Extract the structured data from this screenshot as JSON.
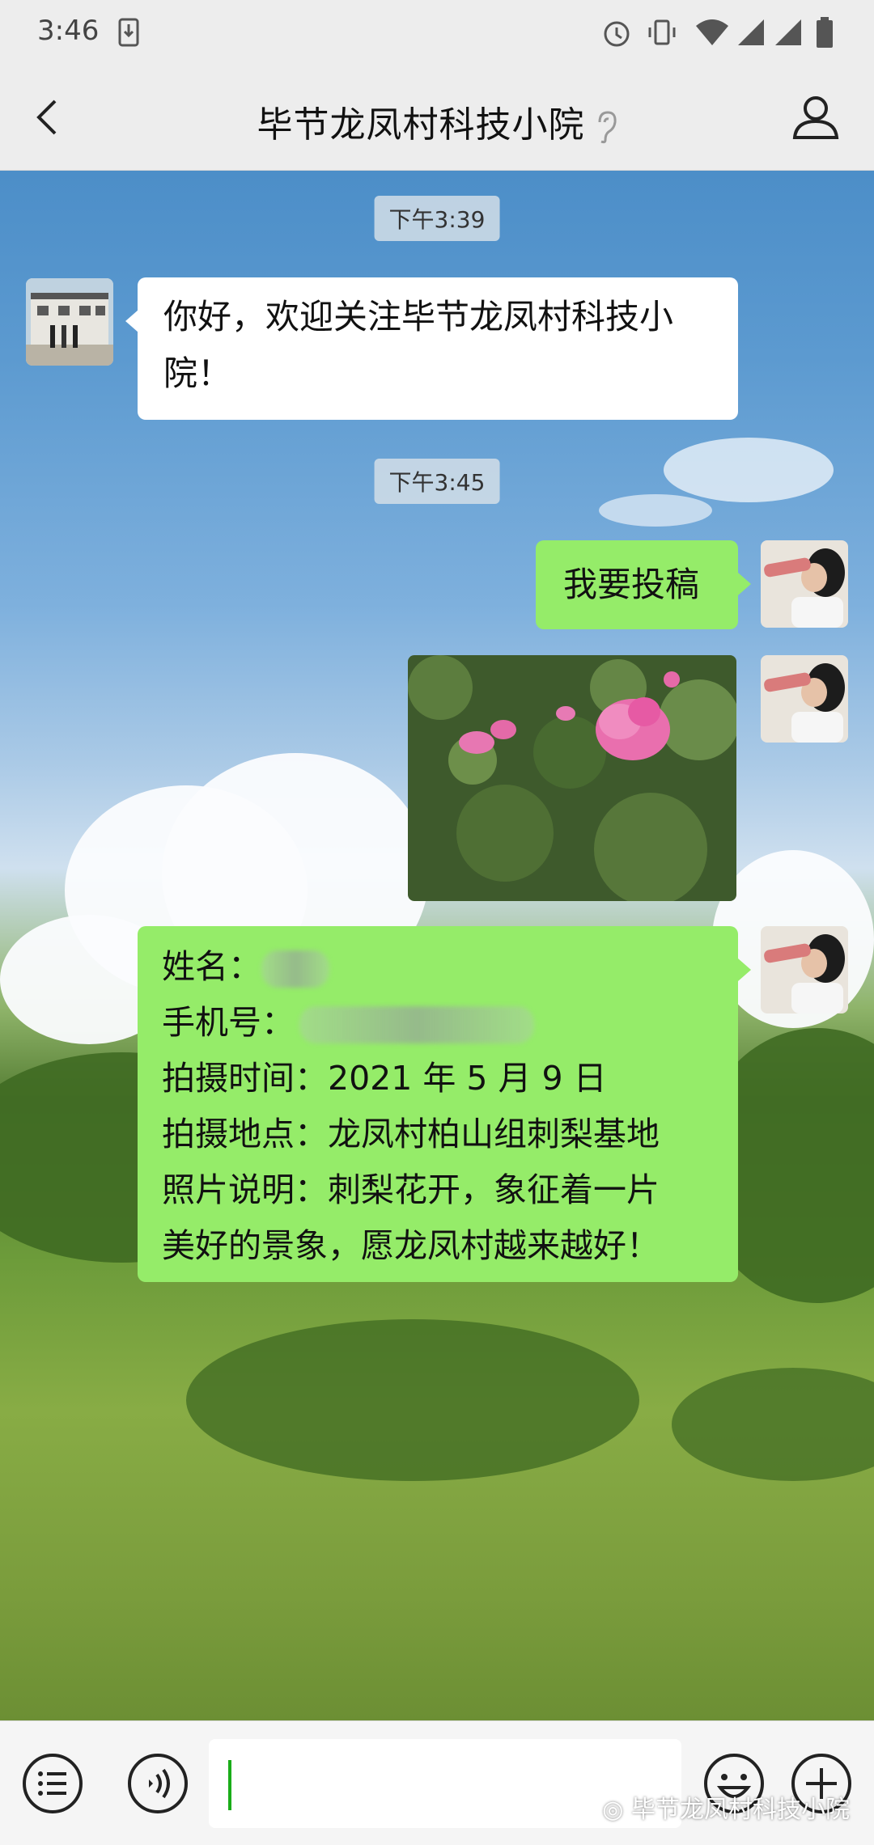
{
  "status_bar": {
    "time": "3:46"
  },
  "header": {
    "title": "毕节龙凤村科技小院"
  },
  "chat": {
    "time_1": "下午3:39",
    "msg_1": "你好，欢迎关注毕节龙凤村科技小院！",
    "time_2": "下午3:45",
    "msg_2": "我要投稿",
    "form": {
      "name_label": "姓名：",
      "phone_label": "手机号：",
      "shoot_time": "拍摄时间：2021 年 5 月 9 日",
      "shoot_place": "拍摄地点：龙凤村柏山组刺梨基地",
      "desc_line1": "照片说明：刺梨花开，象征着一片",
      "desc_line2": "美好的景象，愿龙凤村越来越好！"
    }
  },
  "watermark": "毕节龙凤村科技小院",
  "icons": {
    "back": "chevron-left-icon",
    "ear": "ear-icon",
    "profile": "person-icon",
    "menu": "list-menu-icon",
    "voice": "voice-icon",
    "emoji": "emoji-icon",
    "plus": "plus-icon"
  },
  "colors": {
    "bubble_green": "#95ec69",
    "bubble_white": "#ffffff",
    "cursor": "#1aad19"
  }
}
